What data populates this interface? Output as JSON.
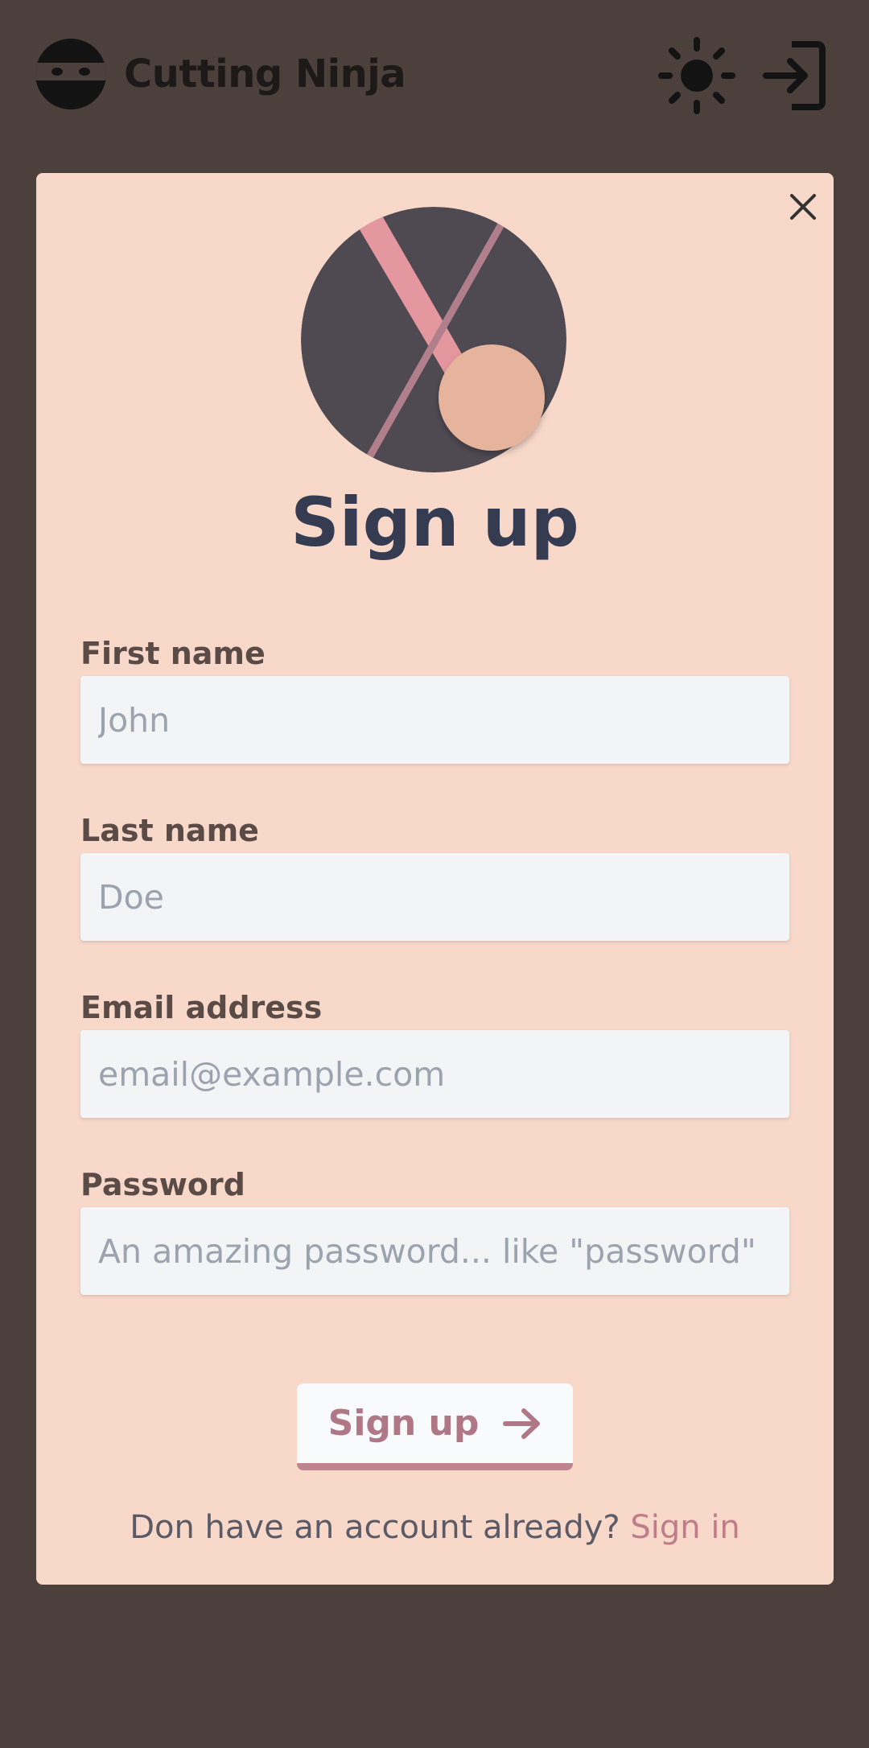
{
  "header": {
    "brand_name": "Cutting Ninja",
    "logo_icon": "ninja-face-icon",
    "theme_icon": "sun-icon",
    "login_icon": "sign-in-icon"
  },
  "modal": {
    "close_icon": "close-icon",
    "title": "Sign up",
    "fields": {
      "first_name": {
        "label": "First name",
        "placeholder": "John",
        "value": ""
      },
      "last_name": {
        "label": "Last name",
        "placeholder": "Doe",
        "value": ""
      },
      "email": {
        "label": "Email address",
        "placeholder": "email@example.com",
        "value": ""
      },
      "password": {
        "label": "Password",
        "placeholder": "An amazing password... like \"password\"",
        "value": ""
      }
    },
    "submit_label": "Sign up",
    "submit_icon": "arrow-right-icon",
    "footer_prompt": "Don have an account already?",
    "footer_link": "Sign in"
  },
  "colors": {
    "page_background": "#4b403c",
    "card_background": "#f8d8c9",
    "title": "#353c52",
    "accent": "#c0848f",
    "input_background": "#f3f4f6"
  }
}
